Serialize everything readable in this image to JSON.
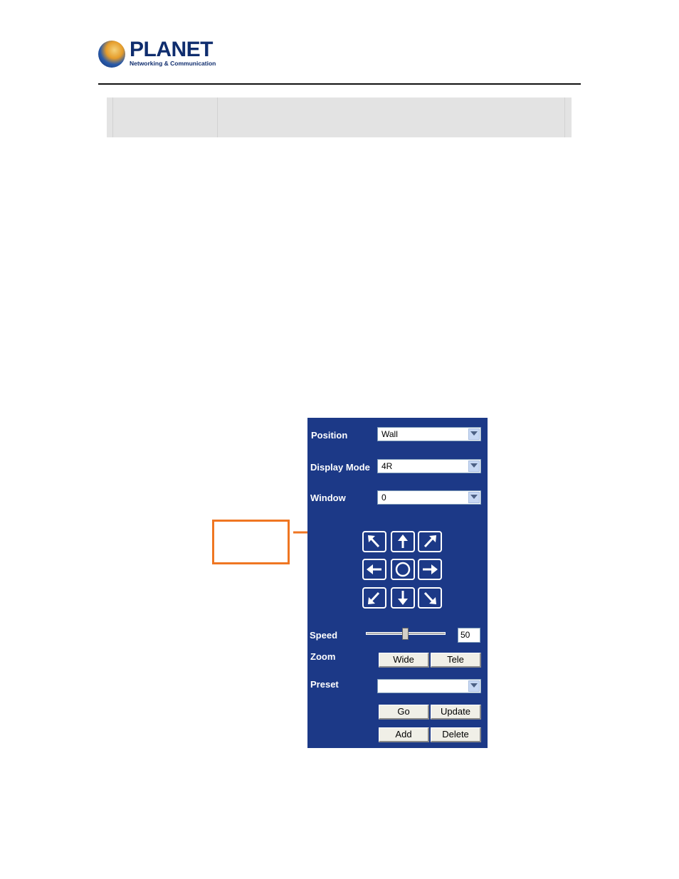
{
  "header": {
    "logo_word": "PLANET",
    "logo_tagline": "Networking & Communication"
  },
  "ptz_panel": {
    "position": {
      "label": "Position",
      "value": "Wall"
    },
    "display_mode": {
      "label": "Display Mode",
      "value": "4R"
    },
    "window": {
      "label": "Window",
      "value": "0"
    },
    "direction_pad": [
      "up-left-arrow-icon",
      "up-arrow-icon",
      "up-right-arrow-icon",
      "left-arrow-icon",
      "home-circle-icon",
      "right-arrow-icon",
      "down-left-arrow-icon",
      "down-arrow-icon",
      "down-right-arrow-icon"
    ],
    "speed": {
      "label": "Speed",
      "value": "50",
      "level": 50
    },
    "zoom": {
      "label": "Zoom",
      "wide": "Wide",
      "tele": "Tele"
    },
    "preset": {
      "label": "Preset",
      "value": "",
      "go": "Go",
      "update": "Update",
      "add": "Add",
      "delete": "Delete"
    }
  },
  "colors": {
    "panel_background": "#1c3987",
    "callout": "#ef7622",
    "header_bar": "#e3e3e3"
  }
}
